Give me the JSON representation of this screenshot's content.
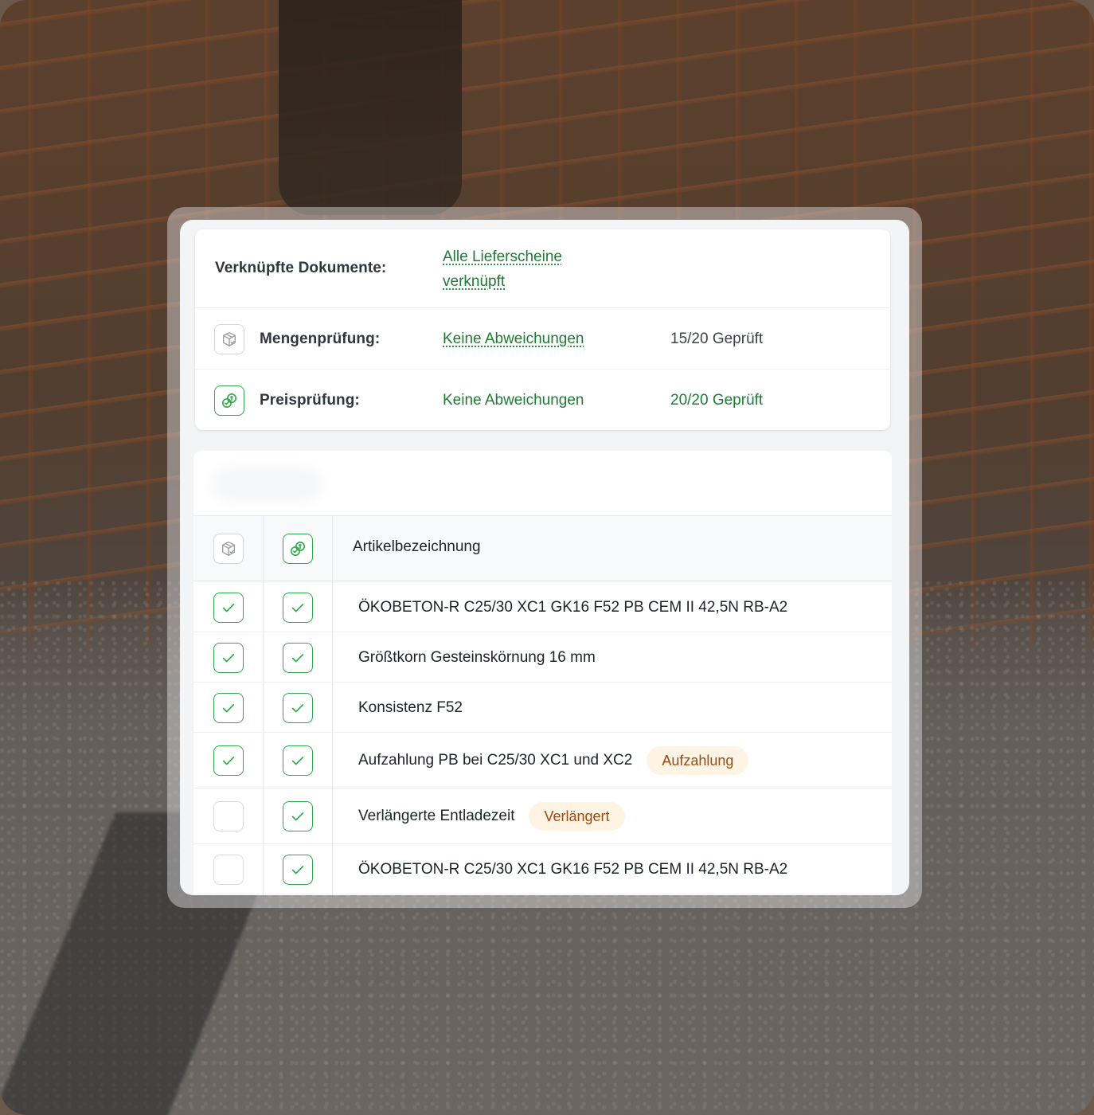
{
  "summary": {
    "linked_docs": {
      "label": "Verknüpfte Dokumente:",
      "value_line1": "Alle Lieferscheine",
      "value_line2": "verknüpft"
    },
    "quantity_check": {
      "label": "Mengenprüfung:",
      "value": "Keine Abweichungen",
      "count": "15/20 Geprüft",
      "icon": "package-check-icon"
    },
    "price_check": {
      "label": "Preisprüfung:",
      "value": "Keine Abweichungen",
      "count": "20/20 Geprüft",
      "icon": "price-tag-check-icon"
    }
  },
  "table": {
    "header": {
      "col1_icon": "package-check-icon",
      "col2_icon": "price-tag-check-icon",
      "col3_label": "Artikelbezeichnung"
    },
    "rows": [
      {
        "quantity_checked": true,
        "price_checked": true,
        "name": "ÖKOBETON-R C25/30 XC1 GK16 F52 PB CEM II 42,5N RB-A2",
        "badge": ""
      },
      {
        "quantity_checked": true,
        "price_checked": true,
        "name": "Größtkorn Gesteinskörnung 16 mm",
        "badge": ""
      },
      {
        "quantity_checked": true,
        "price_checked": true,
        "name": "Konsistenz F52",
        "badge": ""
      },
      {
        "quantity_checked": true,
        "price_checked": true,
        "name": "Aufzahlung PB bei C25/30 XC1 und XC2",
        "badge": "Aufzahlung"
      },
      {
        "quantity_checked": false,
        "price_checked": true,
        "name": "Verlängerte Entladezeit",
        "badge": "Verlängert"
      },
      {
        "quantity_checked": false,
        "price_checked": true,
        "name": "ÖKOBETON-R C25/30 XC1 GK16 F52 PB CEM II 42,5N RB-A2",
        "badge": ""
      }
    ]
  },
  "colors": {
    "accent_green": "#1f7a34",
    "check_border_green": "#2ea84a",
    "badge_bg": "#fdf4e3",
    "badge_text": "#9a4a12"
  }
}
